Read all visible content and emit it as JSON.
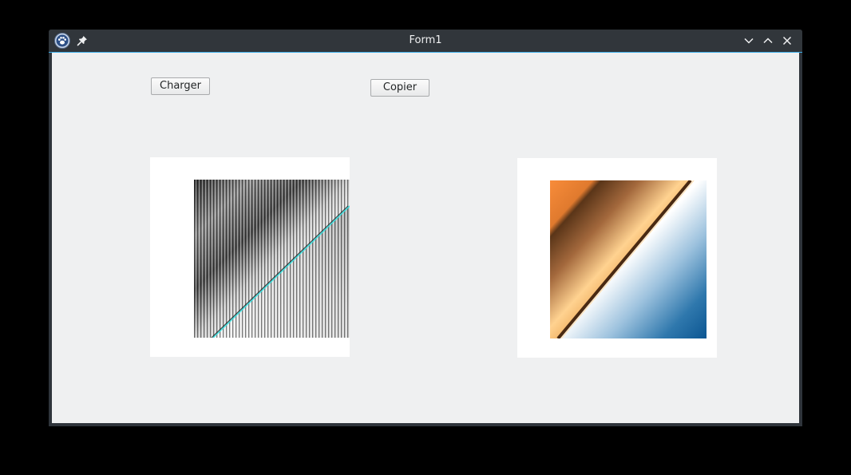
{
  "window": {
    "title": "Form1",
    "icons": {
      "app": "paw-icon",
      "pin": "pin-icon",
      "minimize": "chevron-down-icon",
      "maximize": "chevron-up-icon",
      "close": "close-icon"
    },
    "colors": {
      "titlebar": "#31363b",
      "accent": "#3daee9",
      "client": "#eff0f1"
    }
  },
  "toolbar": {
    "load_label": "Charger",
    "copy_label": "Copier"
  },
  "images": {
    "source": {
      "description_icon": "gradient-striped-image"
    },
    "copy": {
      "description_icon": "gradient-image"
    }
  }
}
